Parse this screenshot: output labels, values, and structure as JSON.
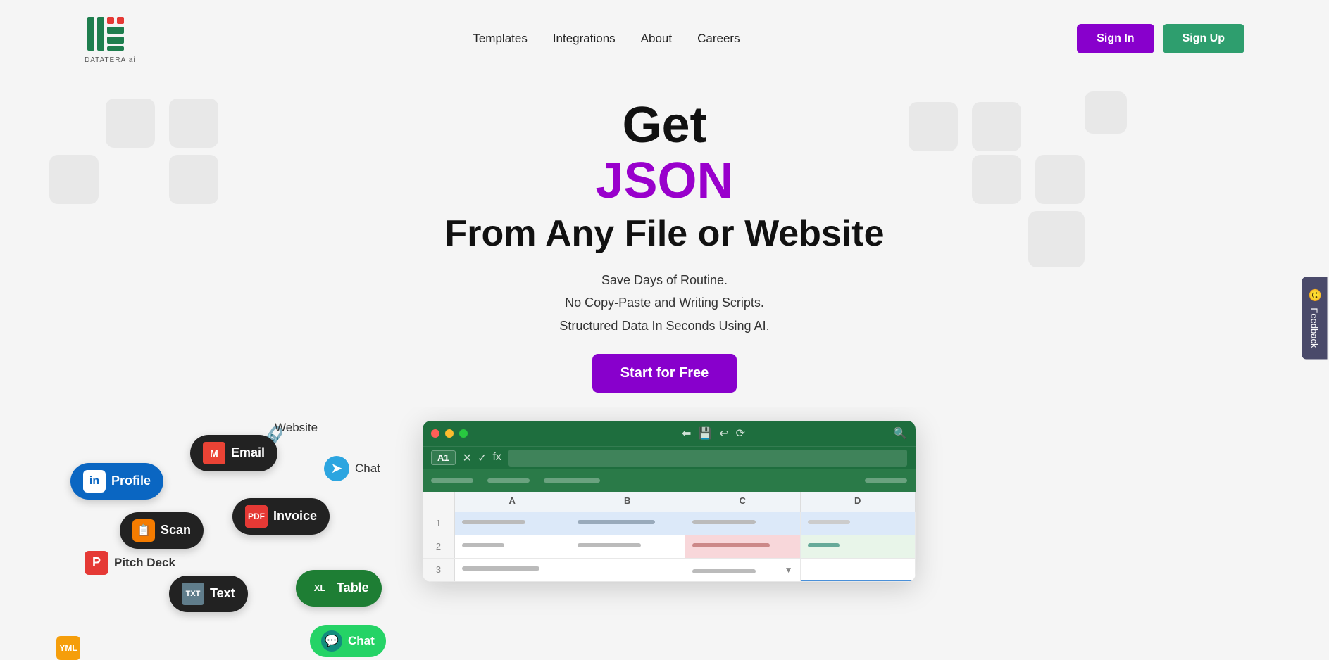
{
  "brand": {
    "name": "DATATERA.ai",
    "logo_letters": "iTi"
  },
  "navbar": {
    "links": [
      {
        "label": "Templates",
        "key": "templates"
      },
      {
        "label": "Integrations",
        "key": "integrations"
      },
      {
        "label": "About",
        "key": "about"
      },
      {
        "label": "Careers",
        "key": "careers"
      }
    ],
    "signin_label": "Sign In",
    "signup_label": "Sign Up"
  },
  "hero": {
    "get_label": "Get",
    "json_label": "JSON",
    "subtitle": "From Any File or Website",
    "desc_line1": "Save Days of Routine.",
    "desc_line2": "No Copy-Paste and Writing Scripts.",
    "desc_line3": "Structured Data In Seconds Using AI.",
    "cta_label": "Start for Free"
  },
  "badges": [
    {
      "id": "linkedin",
      "label": "Profile",
      "icon": "in"
    },
    {
      "id": "email",
      "label": "Email",
      "icon": "M"
    },
    {
      "id": "scan",
      "label": "Scan",
      "icon": "📄"
    },
    {
      "id": "invoice",
      "label": "Invoice",
      "icon": "PDF"
    },
    {
      "id": "pitchdeck",
      "label": "Pitch Deck",
      "icon": "P"
    },
    {
      "id": "text",
      "label": "Text",
      "icon": "TXT"
    },
    {
      "id": "table",
      "label": "Table",
      "icon": "XL"
    },
    {
      "id": "website",
      "label": "Website"
    },
    {
      "id": "chat_telegram",
      "label": "Chat"
    },
    {
      "id": "chat_whatsapp",
      "label": "Chat"
    },
    {
      "id": "in_profile",
      "label": "in Profile"
    }
  ],
  "spreadsheet": {
    "cell_ref": "A1",
    "formula_icon": "fx",
    "columns": [
      "A",
      "B",
      "C",
      "D"
    ],
    "rows": [
      {
        "num": "1",
        "cells": [
          "medium",
          "long",
          "medium",
          "short"
        ]
      },
      {
        "num": "2",
        "cells": [
          "short",
          "medium",
          "long",
          "xshort"
        ]
      },
      {
        "num": "3",
        "cells": [
          "long",
          "",
          "dropdown",
          "blue-border"
        ]
      }
    ]
  },
  "feedback": {
    "label": "Feedback",
    "emoji": "🙂"
  }
}
